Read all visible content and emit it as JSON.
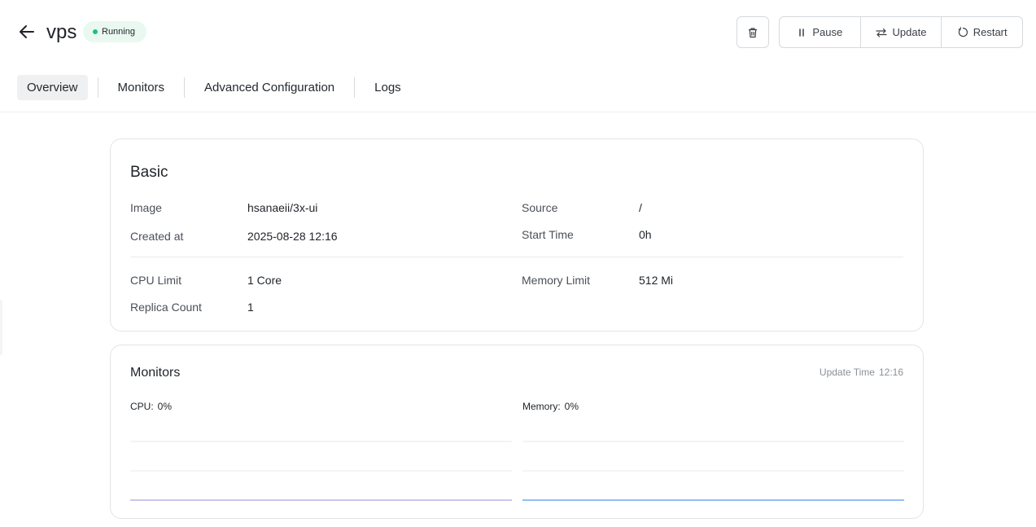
{
  "header": {
    "back_icon": "arrow-left-icon",
    "app_name": "vps",
    "status": {
      "label": "Running",
      "color": "#17c37b"
    },
    "actions": [
      {
        "key": "pause",
        "label": "Pause",
        "icon": "pause-icon"
      },
      {
        "key": "update",
        "label": "Update",
        "icon": "swap-arrows-icon"
      },
      {
        "key": "restart",
        "label": "Restart",
        "icon": "restart-icon"
      }
    ],
    "delete_icon": "trash-icon"
  },
  "tabs": [
    {
      "label": "Overview",
      "active": true
    },
    {
      "label": "Monitors",
      "active": false
    },
    {
      "label": "Advanced Configuration",
      "active": false
    },
    {
      "label": "Logs",
      "active": false
    }
  ],
  "basic": {
    "title": "Basic",
    "image": {
      "label": "Image",
      "value": "hsanaeii/3x-ui"
    },
    "source": {
      "label": "Source",
      "value": "/"
    },
    "created_at": {
      "label": "Created at",
      "value": "2025-08-28 12:16"
    },
    "start_time": {
      "label": "Start Time",
      "value": "0h"
    },
    "cpu_limit": {
      "label": "CPU Limit",
      "value": "1 Core"
    },
    "memory_limit": {
      "label": "Memory Limit",
      "value": "512 Mi"
    },
    "replica_count": {
      "label": "Replica Count",
      "value": "1"
    }
  },
  "monitors": {
    "title": "Monitors",
    "update_time_label": "Update Time",
    "update_time_value": "12:16",
    "cpu": {
      "label": "CPU:",
      "value": "0%",
      "line_color": "#b9b3e3",
      "series_percent": 0
    },
    "memory": {
      "label": "Memory:",
      "value": "0%",
      "line_color": "#6fa8f0",
      "series_percent": 0
    }
  }
}
